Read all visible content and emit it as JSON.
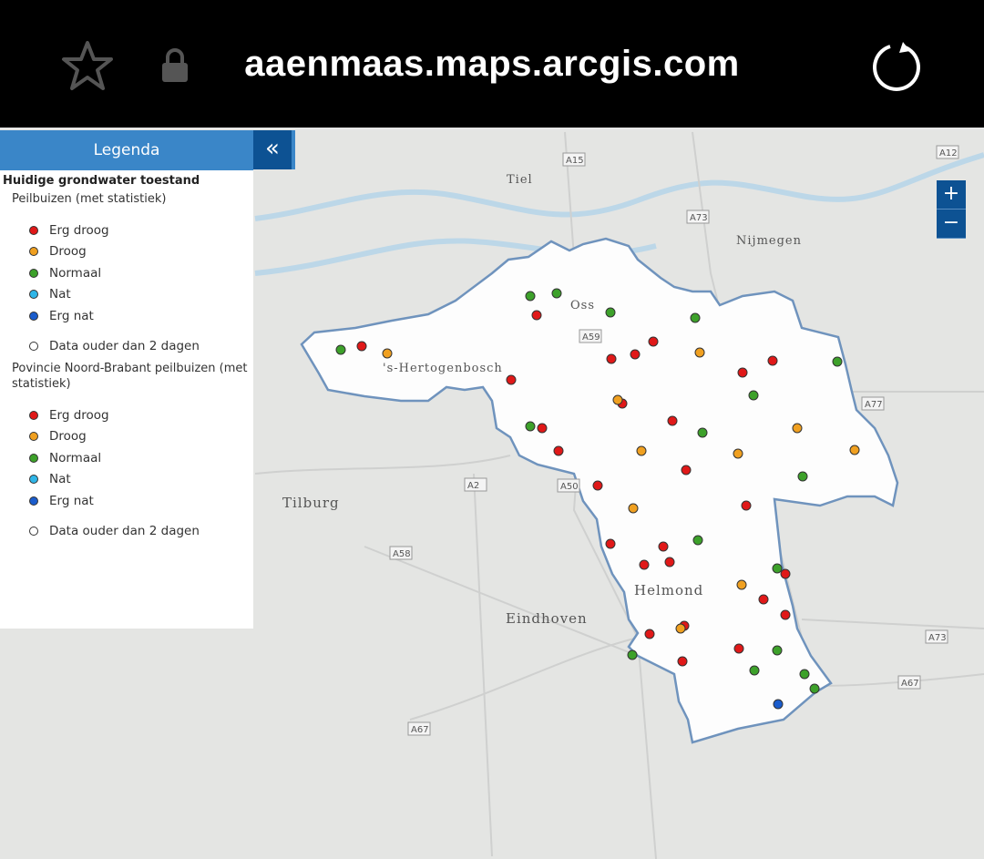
{
  "browser": {
    "url": "aaenmaas.maps.arcgis.com"
  },
  "legend": {
    "header": "Legenda",
    "title": "Huidige grondwater toestand",
    "layers": [
      {
        "name": "Peilbuizen (met statistiek)",
        "items": [
          "Erg droog",
          "Droog",
          "Normaal",
          "Nat",
          "Erg nat",
          "Data ouder dan 2 dagen"
        ]
      },
      {
        "name": "Povincie Noord-Brabant peilbuizen (met statistiek)",
        "items": [
          "Erg droog",
          "Droog",
          "Normaal",
          "Nat",
          "Erg nat",
          "Data ouder dan 2 dagen"
        ]
      }
    ]
  },
  "colors": {
    "erg_droog": "#e01818",
    "droog": "#f0a020",
    "normaal": "#3da12a",
    "nat": "#2fb6e8",
    "erg_nat": "#1a5ccc",
    "old": "#ffffff",
    "accent": "#0d5293"
  },
  "map": {
    "zoom_in": "+",
    "zoom_out": "−",
    "collapse": "«",
    "places": [
      "Tiel",
      "Nijmegen",
      "Oss",
      "'s-Hertogenbosch",
      "Tilburg",
      "Eindhoven",
      "Helmond"
    ],
    "roads": [
      "A15",
      "A12",
      "A73",
      "A59",
      "A77",
      "A2",
      "A50",
      "A58",
      "A73",
      "A67",
      "A67"
    ],
    "point_status_counts": {
      "erg_droog": 29,
      "droog": 10,
      "normaal": 18,
      "erg_nat": 1
    }
  }
}
